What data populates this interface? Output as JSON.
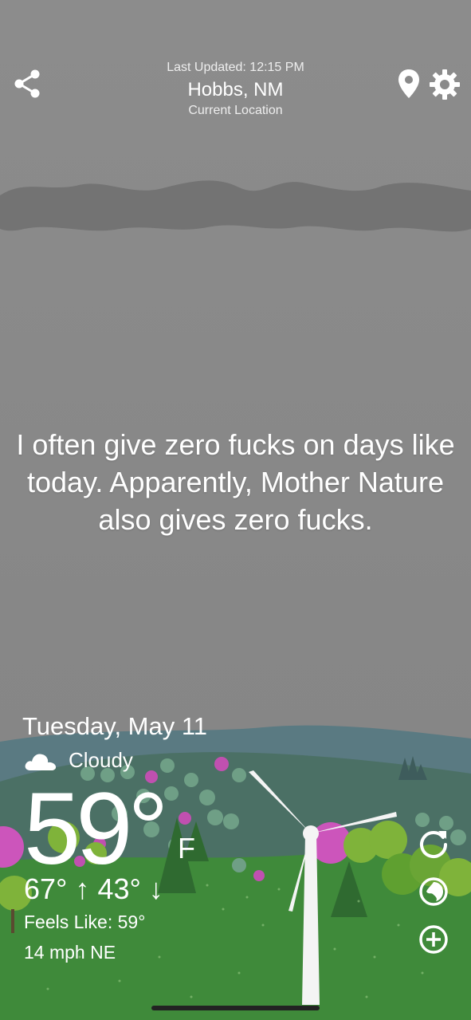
{
  "header": {
    "last_updated": "Last Updated: 12:15 PM",
    "city": "Hobbs, NM",
    "location_label": "Current Location"
  },
  "quote": "I often give zero fucks on days like today. Apparently, Mother Nature also gives zero fucks.",
  "weather": {
    "date": "Tuesday, May 11",
    "condition": "Cloudy",
    "temperature": "59°",
    "unit": "F",
    "hi_lo": "67° ↑ 43° ↓",
    "feels_like": "Feels Like: 59°",
    "wind": "14 mph NE"
  },
  "icons": {
    "share": "share-icon",
    "location": "location-pin-icon",
    "settings": "gear-icon",
    "condition": "cloud-icon",
    "refresh": "refresh-icon",
    "radar": "radar-icon",
    "add": "add-icon"
  },
  "colors": {
    "sky": "#8a8a8a",
    "hills_back": "#5a7a82",
    "hills_mid": "#4b7065",
    "grass": "#3f8a3a",
    "tree_pink": "#cc55bb",
    "tree_green": "#7fb33a"
  }
}
